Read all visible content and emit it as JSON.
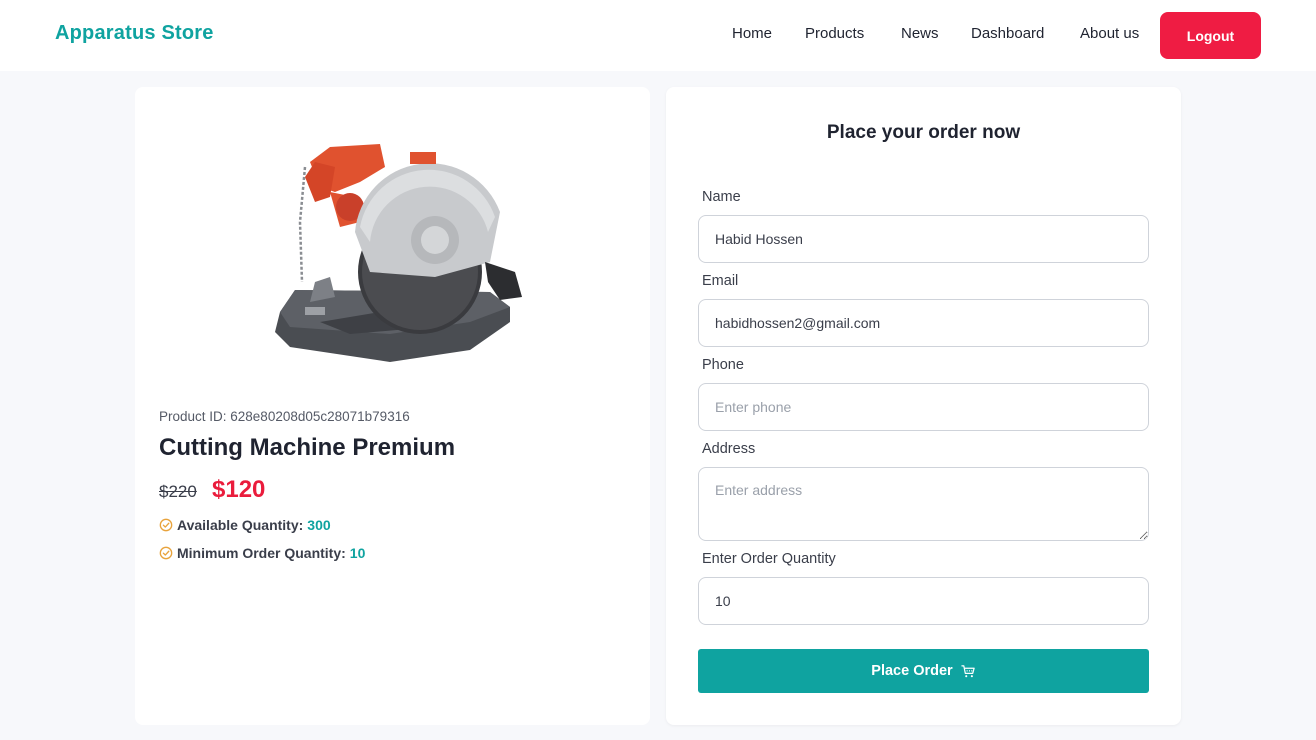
{
  "header": {
    "brand": "Apparatus Store",
    "nav": [
      "Home",
      "Products",
      "News",
      "Dashboard",
      "About us"
    ],
    "logout_label": "Logout"
  },
  "product": {
    "id_label": "Product ID: 628e80208d05c28071b79316",
    "name": "Cutting Machine Premium",
    "price_old": "$220",
    "price_new": "$120",
    "available_label": "Available Quantity:",
    "available_value": "300",
    "min_label": "Minimum Order Quantity:",
    "min_value": "10",
    "image_icon": "cutting-machine-image",
    "check_icon": "check-circle-icon"
  },
  "form": {
    "title": "Place your order now",
    "name_label": "Name",
    "name_value": "Habid Hossen",
    "email_label": "Email",
    "email_value": "habidhossen2@gmail.com",
    "phone_label": "Phone",
    "phone_placeholder": "Enter phone",
    "address_label": "Address",
    "address_placeholder": "Enter address",
    "quantity_label": "Enter Order Quantity",
    "quantity_value": "10",
    "submit_label": "Place Order",
    "submit_icon": "cart-icon"
  },
  "colors": {
    "brand": "#0fa3a0",
    "logout": "#ef1c43",
    "price": "#ea1c3c",
    "check": "#e8a33c",
    "background": "#f7f8fb"
  }
}
